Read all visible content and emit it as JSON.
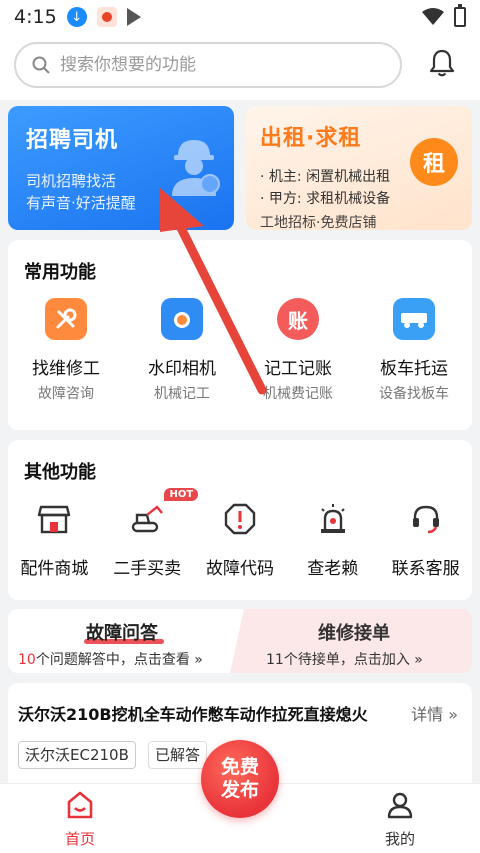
{
  "status_bar": {
    "time": "4:15"
  },
  "search": {
    "placeholder": "搜索你想要的功能"
  },
  "hero": {
    "left": {
      "title": "招聘司机",
      "line1": "司机招聘找活",
      "line2": "有声音·好活提醒"
    },
    "right": {
      "title": "出租·求租",
      "badge": "租",
      "line1": "· 机主: 闲置机械出租",
      "line2": "· 甲方: 求租机械设备",
      "line3": "工地招标·免费店铺"
    }
  },
  "common": {
    "title": "常用功能",
    "items": [
      {
        "label": "找维修工",
        "sub": "故障咨询",
        "icon": "wrench-icon"
      },
      {
        "label": "水印相机",
        "sub": "机械记工",
        "icon": "camera-icon"
      },
      {
        "label": "记工记账",
        "sub": "机械费记账",
        "icon": "ledger-icon"
      },
      {
        "label": "板车托运",
        "sub": "设备找板车",
        "icon": "truck-icon"
      }
    ]
  },
  "other": {
    "title": "其他功能",
    "hot": "HOT",
    "items": [
      {
        "label": "配件商城",
        "icon": "shop-icon"
      },
      {
        "label": "二手买卖",
        "icon": "excavator-icon"
      },
      {
        "label": "故障代码",
        "icon": "alert-icon"
      },
      {
        "label": "查老赖",
        "icon": "siren-icon"
      },
      {
        "label": "联系客服",
        "icon": "headset-icon"
      }
    ]
  },
  "tabs": {
    "a": {
      "title": "故障问答",
      "count": "10",
      "sub": "个问题解答中，点击查看 »"
    },
    "b": {
      "title": "维修接单",
      "sub": "11个待接单，点击加入 »"
    }
  },
  "question": {
    "title": "沃尔沃210B挖机全车动作憋车动作拉死直接熄火",
    "more": "详情 »",
    "tag1": "沃尔沃EC210B",
    "tag2": "已解答"
  },
  "tabbar": {
    "home": "首页",
    "publish": "免费发布",
    "mine": "我的"
  },
  "colors": {
    "primary_red": "#e8333a",
    "blue": "#1a73f0",
    "orange": "#ff7a1a"
  }
}
